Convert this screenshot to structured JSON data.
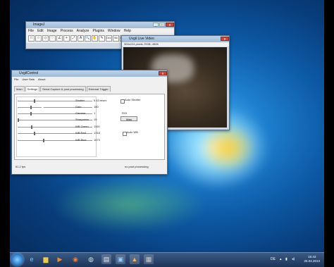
{
  "imagej": {
    "title": "ImageJ",
    "menu": [
      "File",
      "Edit",
      "Image",
      "Process",
      "Analyze",
      "Plugins",
      "Window",
      "Help"
    ],
    "tools": [
      "□",
      "○",
      "◇",
      "♡",
      "∠",
      "+",
      "⤢",
      "A",
      "🔍",
      "✋",
      "✎",
      "Dev",
      "Stk",
      "LUT",
      "✏",
      "⬛",
      "⁄",
      "»"
    ]
  },
  "video": {
    "title": "Uvgil Live Video",
    "info": "300x224 pixels; RGB; 450K"
  },
  "control": {
    "title": "UvgilControl",
    "menu": [
      "File",
      "User Sets",
      "About"
    ],
    "tabs": [
      "Main",
      "Settings",
      "Serial Capture & post processing",
      "External Trigger"
    ],
    "rows": [
      {
        "label": "Shutter",
        "value": "5.43 msec"
      },
      {
        "label": "Gain",
        "value": "180"
      },
      {
        "label": "Gamma",
        "value": "1"
      },
      {
        "label": "Sharpness",
        "value": "15"
      },
      {
        "label": "WB Green",
        "value": "1100"
      },
      {
        "label": "WB Red",
        "value": "1318"
      },
      {
        "label": "WB Blue",
        "value": "1673"
      }
    ],
    "auto_shutter": "Auto Shutter",
    "roi_label": "ROI",
    "roi_button": "Man",
    "auto_wb": "Auto WB",
    "fps": "61.2 fps",
    "post": "no post processing"
  },
  "taskbar": {
    "lang": "DE",
    "time": "16:43",
    "date": "25.04.2013"
  }
}
